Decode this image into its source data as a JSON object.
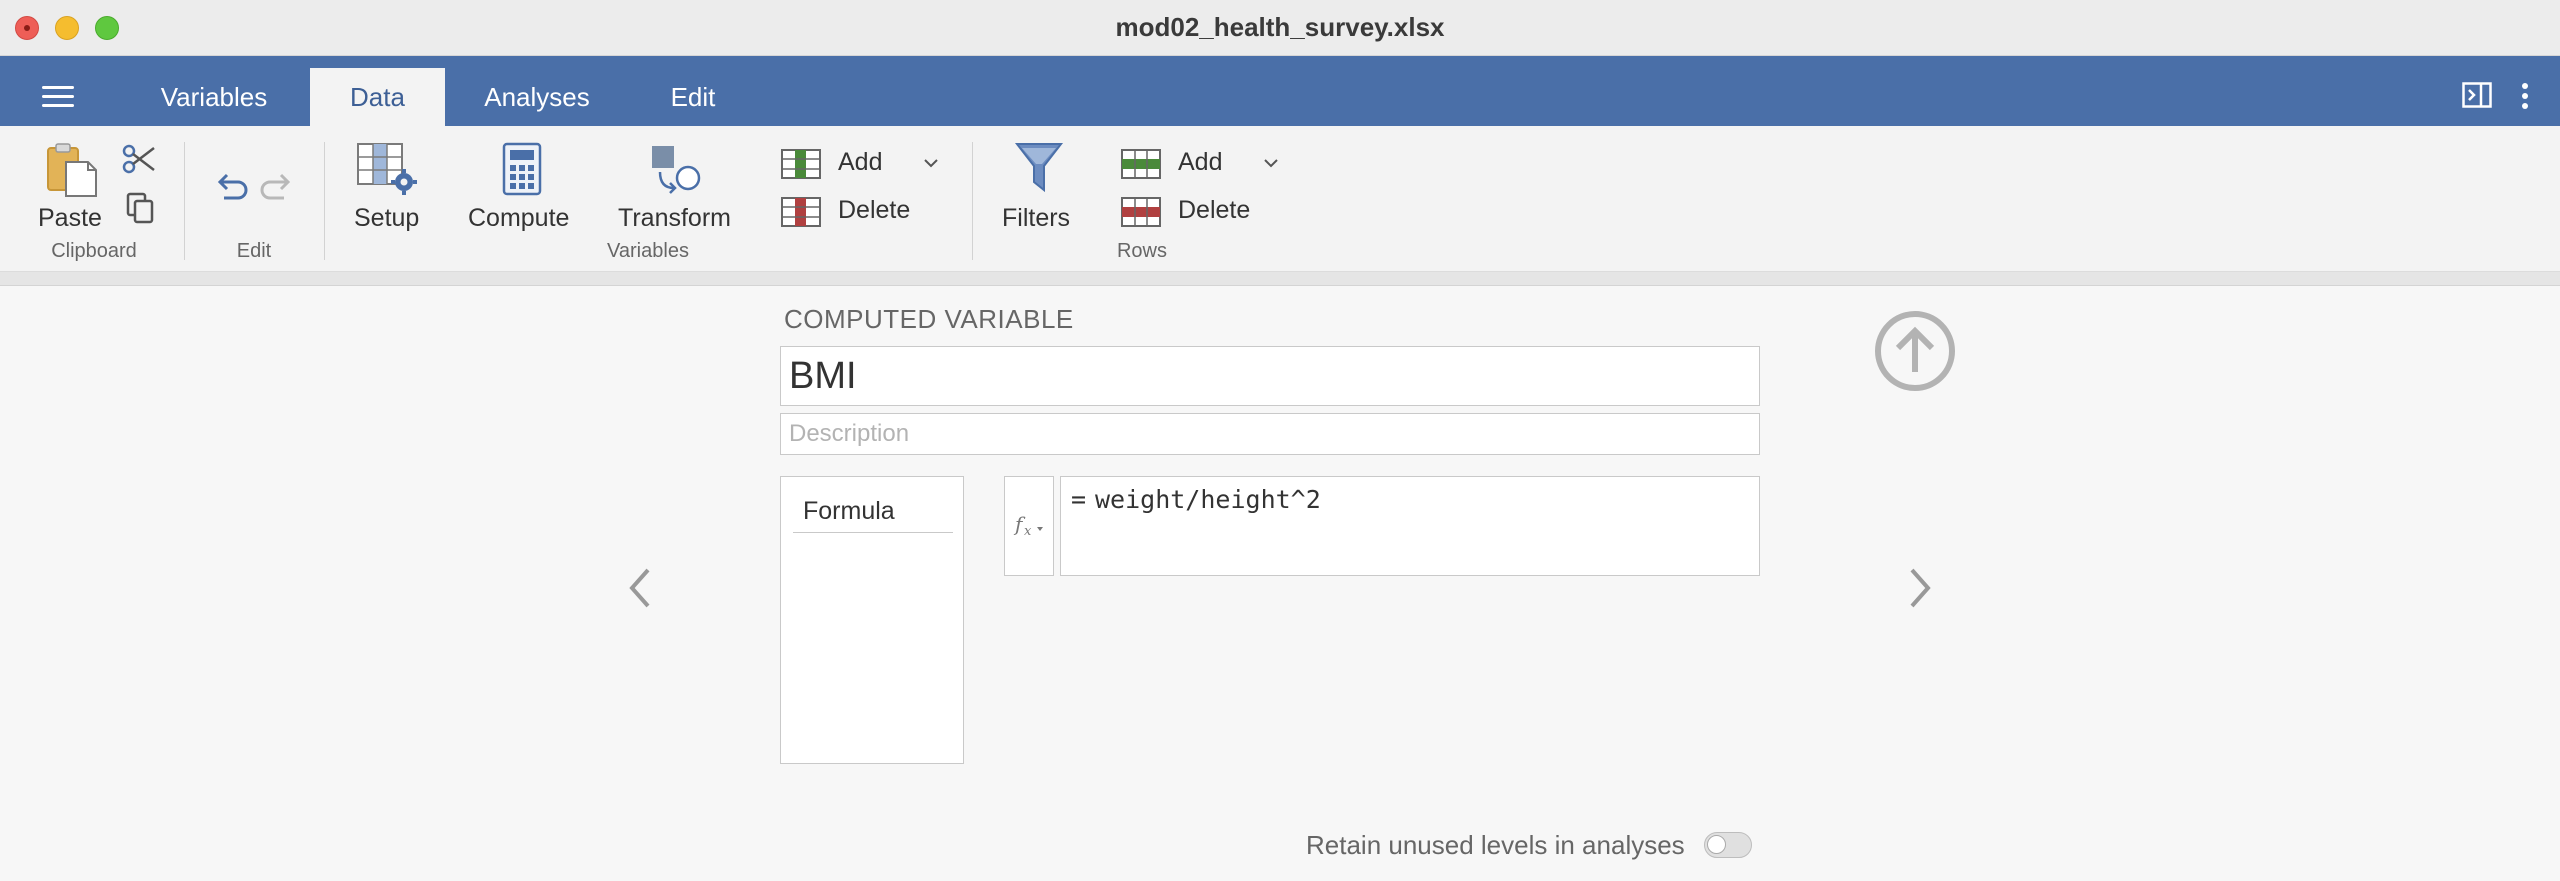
{
  "window": {
    "title": "mod02_health_survey.xlsx"
  },
  "menubar": {
    "tabs": [
      {
        "label": "Variables",
        "active": false
      },
      {
        "label": "Data",
        "active": true
      },
      {
        "label": "Analyses",
        "active": false
      },
      {
        "label": "Edit",
        "active": false
      }
    ]
  },
  "ribbon": {
    "clipboard": {
      "paste_label": "Paste",
      "group_label": "Clipboard"
    },
    "edit": {
      "group_label": "Edit"
    },
    "variables": {
      "setup_label": "Setup",
      "compute_label": "Compute",
      "transform_label": "Transform",
      "add_label": "Add",
      "delete_label": "Delete",
      "group_label": "Variables"
    },
    "filters_label": "Filters",
    "rows": {
      "add_label": "Add",
      "delete_label": "Delete",
      "group_label": "Rows"
    }
  },
  "editor": {
    "header": "COMPUTED VARIABLE",
    "name_value": "BMI",
    "description_placeholder": "Description",
    "formula_tab": "Formula",
    "formula_eq": "=",
    "formula_value": "weight/height^2",
    "retain_label": "Retain unused levels in analyses",
    "retain_enabled": false
  },
  "colors": {
    "menubar": "#4a6fa8",
    "active_tab_text": "#3d5f95",
    "icon_blue": "#4a6fa8",
    "add_green": "#4a8a3a",
    "delete_red": "#b04040"
  }
}
